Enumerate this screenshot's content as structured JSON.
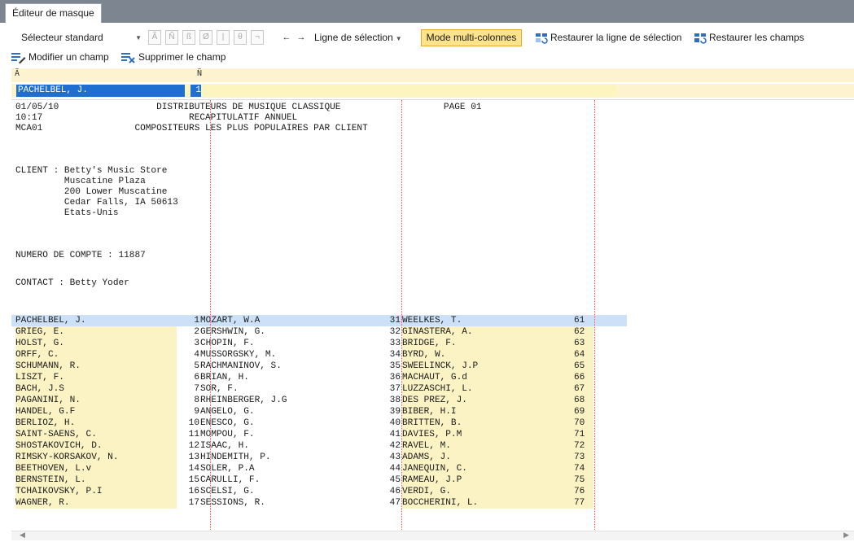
{
  "tab": {
    "label": "Éditeur de masque"
  },
  "toolbar": {
    "selector_value": "Sélecteur standard",
    "mini_buttons": [
      "Ã",
      "Ñ",
      "ß",
      "Ø",
      "|",
      "θ",
      "¬"
    ],
    "nav_left": "←",
    "nav_right": "→",
    "line_selection": "Ligne de sélection",
    "multi_column": "Mode multi-colonnes",
    "restore_line": "Restaurer la ligne de sélection",
    "restore_fields": "Restaurer les champs",
    "edit_field": "Modifier un champ",
    "delete_field": "Supprimer le champ"
  },
  "column_headers": [
    "Ã",
    "Ñ"
  ],
  "selected_field": {
    "value": "PACHELBEL, J.",
    "number": "1"
  },
  "report_header": [
    "01/05/10                  DISTRIBUTEURS DE MUSIQUE CLASSIQUE                   PAGE 01",
    "10:17                           RECAPITULATIF ANNUEL",
    "MCA01                 COMPOSITEURS LES PLUS POPULAIRES PAR CLIENT"
  ],
  "client": [
    "CLIENT : Betty's Music Store",
    "         Muscatine Plaza",
    "         200 Lower Muscatine",
    "         Cedar Falls, IA 50613",
    "         Etats-Unis"
  ],
  "account": "NUMERO DE COMPTE : 11887",
  "contact": "CONTACT : Betty Yoder",
  "rows": [
    {
      "c1": "PACHELBEL, J.",
      "n1": "1",
      "c2": "MOZART, W.A",
      "n2": "31",
      "c3": "WEELKES, T.",
      "n3": "61"
    },
    {
      "c1": "GRIEG, E.",
      "n1": "2",
      "c2": "GERSHWIN, G.",
      "n2": "32",
      "c3": "GINASTERA, A.",
      "n3": "62"
    },
    {
      "c1": "HOLST, G.",
      "n1": "3",
      "c2": "CHOPIN, F.",
      "n2": "33",
      "c3": "BRIDGE, F.",
      "n3": "63"
    },
    {
      "c1": "ORFF, C.",
      "n1": "4",
      "c2": "MUSSORGSKY, M.",
      "n2": "34",
      "c3": "BYRD, W.",
      "n3": "64"
    },
    {
      "c1": "SCHUMANN, R.",
      "n1": "5",
      "c2": "RACHMANINOV, S.",
      "n2": "35",
      "c3": "SWEELINCK, J.P",
      "n3": "65"
    },
    {
      "c1": "LISZT, F.",
      "n1": "6",
      "c2": "BRIAN, H.",
      "n2": "36",
      "c3": "MACHAUT, G.d",
      "n3": "66"
    },
    {
      "c1": "BACH, J.S",
      "n1": "7",
      "c2": "SOR, F.",
      "n2": "37",
      "c3": "LUZZASCHI, L.",
      "n3": "67"
    },
    {
      "c1": "PAGANINI, N.",
      "n1": "8",
      "c2": "RHEINBERGER, J.G",
      "n2": "38",
      "c3": "DES PREZ, J.",
      "n3": "68"
    },
    {
      "c1": "HANDEL, G.F",
      "n1": "9",
      "c2": "ANGELO, G.",
      "n2": "39",
      "c3": "BIBER, H.I",
      "n3": "69"
    },
    {
      "c1": "BERLIOZ, H.",
      "n1": "10",
      "c2": "ENESCO, G.",
      "n2": "40",
      "c3": "BRITTEN, B.",
      "n3": "70"
    },
    {
      "c1": "SAINT-SAENS, C.",
      "n1": "11",
      "c2": "MOMPOU, F.",
      "n2": "41",
      "c3": "DAVIES, P.M",
      "n3": "71"
    },
    {
      "c1": "SHOSTAKOVICH, D.",
      "n1": "12",
      "c2": "ISAAC, H.",
      "n2": "42",
      "c3": "RAVEL, M.",
      "n3": "72"
    },
    {
      "c1": "RIMSKY-KORSAKOV, N.",
      "n1": "13",
      "c2": "HINDEMITH, P.",
      "n2": "43",
      "c3": "ADAMS, J.",
      "n3": "73"
    },
    {
      "c1": "BEETHOVEN, L.v",
      "n1": "14",
      "c2": "SOLER, P.A",
      "n2": "44",
      "c3": "JANEQUIN, C.",
      "n3": "74"
    },
    {
      "c1": "BERNSTEIN, L.",
      "n1": "15",
      "c2": "CARULLI, F.",
      "n2": "45",
      "c3": "RAMEAU, J.P",
      "n3": "75"
    },
    {
      "c1": "TCHAIKOVSKY, P.I",
      "n1": "16",
      "c2": "SCELSI, G.",
      "n2": "46",
      "c3": "VERDI, G.",
      "n3": "76"
    },
    {
      "c1": "WAGNER, R.",
      "n1": "17",
      "c2": "SESSIONS, R.",
      "n2": "47",
      "c3": "BOCCHERINI, L.",
      "n3": "77"
    }
  ],
  "scrollbar": {
    "left": "◀",
    "right": "▶"
  },
  "colors": {
    "accent": "#1f6fd0",
    "highlight": "#fcf3c4",
    "selection": "#cce1f7",
    "active_mode": "#fde48a"
  }
}
